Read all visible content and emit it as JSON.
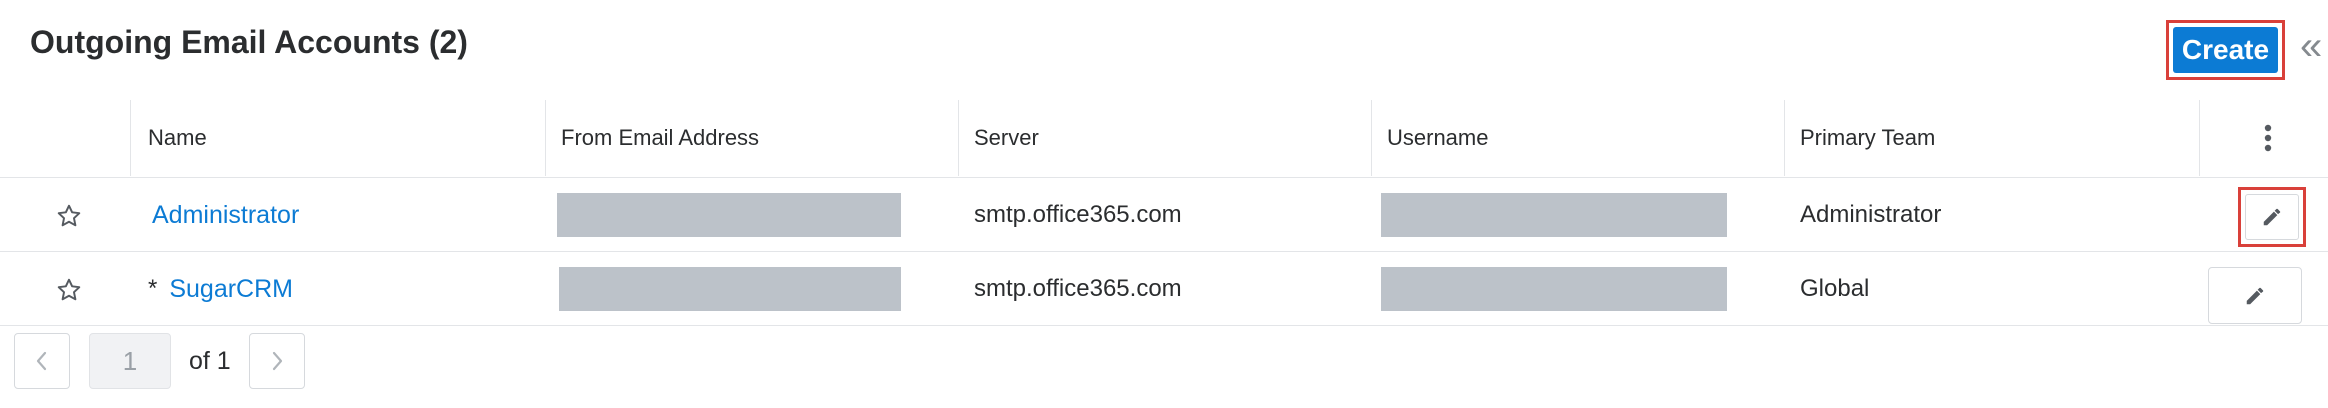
{
  "header": {
    "title": "Outgoing Email Accounts (2)",
    "create_label": "Create",
    "collapse_glyph": "«"
  },
  "columns": {
    "name": "Name",
    "from": "From Email Address",
    "server": "Server",
    "username": "Username",
    "team": "Primary Team"
  },
  "rows": [
    {
      "name": "Administrator",
      "prefix": "",
      "server": "smtp.office365.com",
      "team": "Administrator",
      "edit_highlighted": true
    },
    {
      "name": "SugarCRM",
      "prefix": "*",
      "server": "smtp.office365.com",
      "team": "Global",
      "edit_highlighted": false
    }
  ],
  "pagination": {
    "current_page": "1",
    "of_label": "of 1"
  },
  "icons": {
    "star": "star-outline-icon",
    "edit": "pencil-icon",
    "kebab": "vertical-dots-icon",
    "collapse": "double-chevron-left-icon",
    "prev": "chevron-left-icon",
    "next": "chevron-right-icon"
  },
  "colors": {
    "accent": "#0c7bd4",
    "highlight": "#d9403a",
    "redaction": "#bcc2c9"
  }
}
